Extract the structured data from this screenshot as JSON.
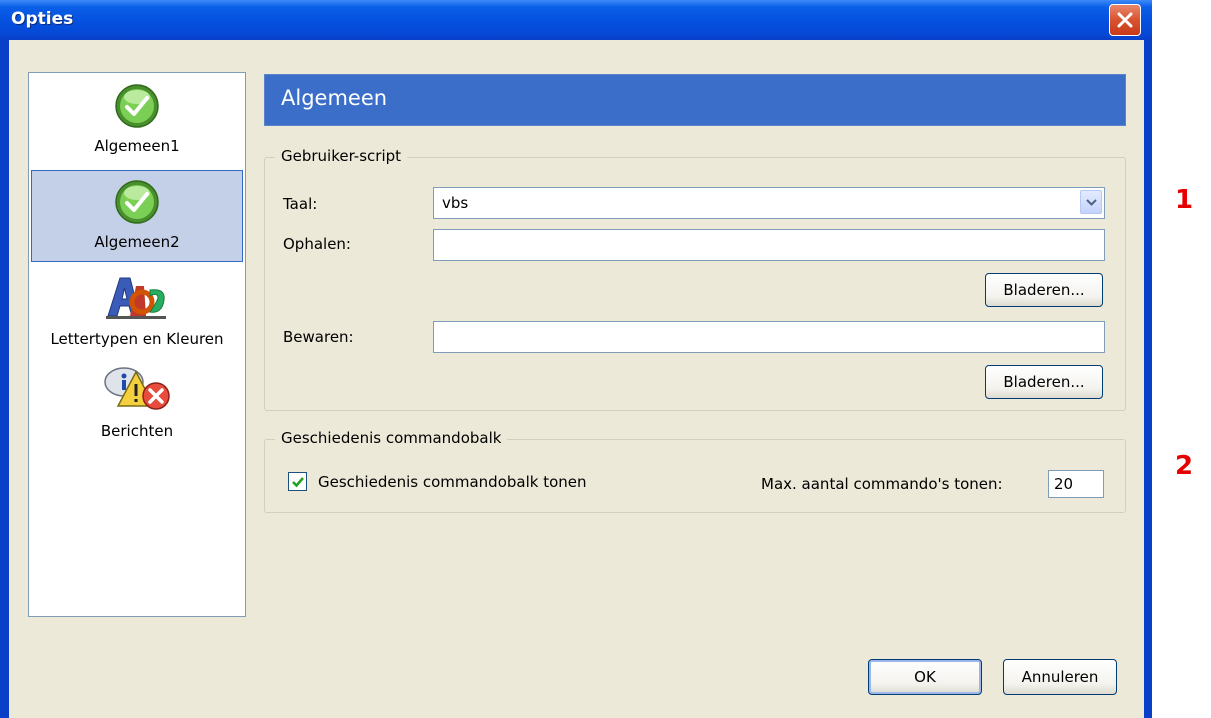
{
  "window": {
    "title": "Opties"
  },
  "sidebar": {
    "items": [
      {
        "label": "Algemeen1",
        "icon": "checkmark-icon",
        "selected": false
      },
      {
        "label": "Algemeen2",
        "icon": "checkmark-icon",
        "selected": true
      },
      {
        "label": "Lettertypen en Kleuren",
        "icon": "fonts-colors-icon",
        "selected": false
      },
      {
        "label": "Berichten",
        "icon": "messages-icon",
        "selected": false
      }
    ]
  },
  "panel": {
    "header": "Algemeen",
    "user_script": {
      "title": "Gebruiker-script",
      "language_label": "Taal:",
      "language_value": "vbs",
      "load_label": "Ophalen:",
      "load_value": "",
      "load_browse": "Bladeren...",
      "save_label": "Bewaren:",
      "save_value": "",
      "save_browse": "Bladeren..."
    },
    "history": {
      "title": "Geschiedenis commandobalk",
      "show_label": "Geschiedenis commandobalk tonen",
      "show_checked": true,
      "max_label": "Max. aantal commando's tonen:",
      "max_value": "20"
    }
  },
  "buttons": {
    "ok": "OK",
    "cancel": "Annuleren"
  },
  "markers": {
    "one": "1",
    "two": "2"
  },
  "colors": {
    "titlebar": "#0551e0",
    "header": "#3a6ec8",
    "dialog_bg": "#ece9d8",
    "marker": "#e60000"
  }
}
